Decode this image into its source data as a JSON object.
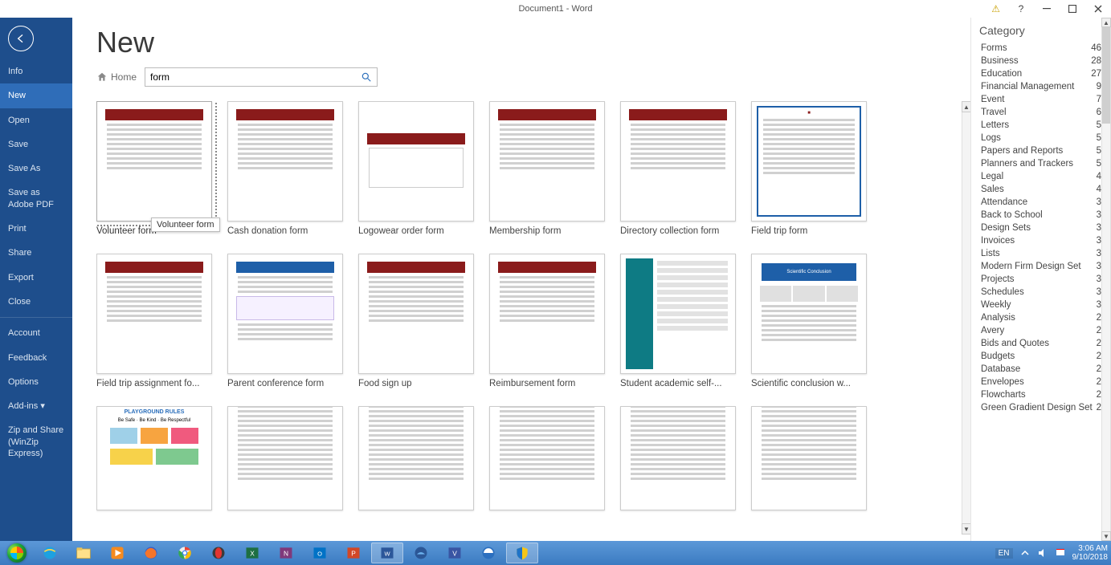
{
  "title_bar": {
    "doc_title": "Document1 - Word"
  },
  "sidebar": {
    "items": [
      {
        "label": "Info"
      },
      {
        "label": "New"
      },
      {
        "label": "Open"
      },
      {
        "label": "Save"
      },
      {
        "label": "Save As"
      },
      {
        "label": "Save as Adobe PDF"
      },
      {
        "label": "Print"
      },
      {
        "label": "Share"
      },
      {
        "label": "Export"
      },
      {
        "label": "Close"
      }
    ],
    "lower": [
      {
        "label": "Account"
      },
      {
        "label": "Feedback"
      },
      {
        "label": "Options"
      },
      {
        "label": "Add-ins ▾"
      },
      {
        "label": "Zip and Share (WinZip Express)"
      }
    ]
  },
  "page": {
    "title": "New",
    "home": "Home",
    "search_value": "form",
    "tooltip": "Volunteer form"
  },
  "templates": [
    {
      "label": "Volunteer form",
      "style": "red-form",
      "selected": true
    },
    {
      "label": "Cash donation form",
      "style": "red-form"
    },
    {
      "label": "Logowear order form",
      "style": "red-box"
    },
    {
      "label": "Membership form",
      "style": "red-form"
    },
    {
      "label": "Directory collection form",
      "style": "red-form"
    },
    {
      "label": "Field trip form",
      "style": "blue-doc"
    },
    {
      "label": "Field trip assignment fo...",
      "style": "red-form"
    },
    {
      "label": "Parent conference form",
      "style": "blue-form"
    },
    {
      "label": "Food sign up",
      "style": "red-form"
    },
    {
      "label": "Reimbursement form",
      "style": "red-form"
    },
    {
      "label": "Student academic self-...",
      "style": "teal-side"
    },
    {
      "label": "Scientific conclusion w...",
      "style": "blue-banner"
    },
    {
      "label": "",
      "style": "rules"
    },
    {
      "label": "",
      "style": "plain-doc"
    },
    {
      "label": "",
      "style": "plain-doc"
    },
    {
      "label": "",
      "style": "plain-doc"
    },
    {
      "label": "",
      "style": "plain-doc"
    },
    {
      "label": "",
      "style": "plain-doc"
    }
  ],
  "category": {
    "heading": "Category",
    "items": [
      {
        "name": "Forms",
        "count": 46
      },
      {
        "name": "Business",
        "count": 28
      },
      {
        "name": "Education",
        "count": 27
      },
      {
        "name": "Financial Management",
        "count": 9
      },
      {
        "name": "Event",
        "count": 7
      },
      {
        "name": "Travel",
        "count": 6
      },
      {
        "name": "Letters",
        "count": 5
      },
      {
        "name": "Logs",
        "count": 5
      },
      {
        "name": "Papers and Reports",
        "count": 5
      },
      {
        "name": "Planners and Trackers",
        "count": 5
      },
      {
        "name": "Legal",
        "count": 4
      },
      {
        "name": "Sales",
        "count": 4
      },
      {
        "name": "Attendance",
        "count": 3
      },
      {
        "name": "Back to School",
        "count": 3
      },
      {
        "name": "Design Sets",
        "count": 3
      },
      {
        "name": "Invoices",
        "count": 3
      },
      {
        "name": "Lists",
        "count": 3
      },
      {
        "name": "Modern Firm Design Set",
        "count": 3
      },
      {
        "name": "Projects",
        "count": 3
      },
      {
        "name": "Schedules",
        "count": 3
      },
      {
        "name": "Weekly",
        "count": 3
      },
      {
        "name": "Analysis",
        "count": 2
      },
      {
        "name": "Avery",
        "count": 2
      },
      {
        "name": "Bids and Quotes",
        "count": 2
      },
      {
        "name": "Budgets",
        "count": 2
      },
      {
        "name": "Database",
        "count": 2
      },
      {
        "name": "Envelopes",
        "count": 2
      },
      {
        "name": "Flowcharts",
        "count": 2
      },
      {
        "name": "Green Gradient Design Set",
        "count": 2
      }
    ]
  },
  "taskbar": {
    "lang": "EN",
    "time": "3:06 AM",
    "date": "9/10/2018"
  }
}
